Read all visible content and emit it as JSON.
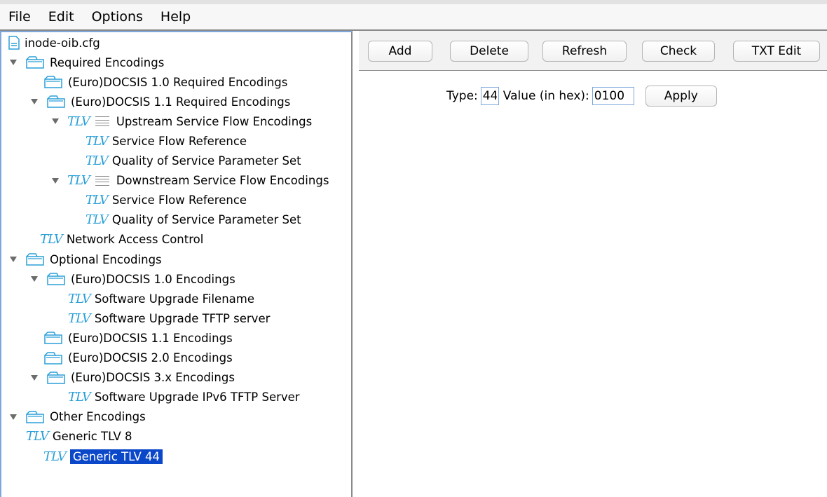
{
  "menu": [
    "File",
    "Edit",
    "Options",
    "Help"
  ],
  "tree": {
    "file": "inode-oib.cfg",
    "nodes": [
      {
        "label": "Required Encodings",
        "icon": "folder-icon"
      },
      {
        "label": "(Euro)DOCSIS 1.0 Required Encodings",
        "icon": "folder-icon"
      },
      {
        "label": "(Euro)DOCSIS 1.1 Required Encodings",
        "icon": "folder-icon"
      },
      {
        "label": "Upstream Service Flow Encodings",
        "icon": "tlv-list-icon"
      },
      {
        "label": "Service Flow Reference",
        "icon": "tlv-icon"
      },
      {
        "label": "Quality of Service Parameter Set",
        "icon": "tlv-icon"
      },
      {
        "label": "Downstream Service Flow Encodings",
        "icon": "tlv-list-icon"
      },
      {
        "label": "Service Flow Reference",
        "icon": "tlv-icon"
      },
      {
        "label": "Quality of Service Parameter Set",
        "icon": "tlv-icon"
      },
      {
        "label": "Network Access Control",
        "icon": "tlv-icon"
      },
      {
        "label": "Optional Encodings",
        "icon": "folder-icon"
      },
      {
        "label": "(Euro)DOCSIS 1.0 Encodings",
        "icon": "folder-icon"
      },
      {
        "label": "Software Upgrade Filename",
        "icon": "tlv-icon"
      },
      {
        "label": "Software Upgrade TFTP server",
        "icon": "tlv-icon"
      },
      {
        "label": "(Euro)DOCSIS 1.1 Encodings",
        "icon": "folder-icon"
      },
      {
        "label": "(Euro)DOCSIS 2.0 Encodings",
        "icon": "folder-icon"
      },
      {
        "label": "(Euro)DOCSIS 3.x Encodings",
        "icon": "folder-icon"
      },
      {
        "label": "Software Upgrade IPv6 TFTP Server",
        "icon": "tlv-icon"
      },
      {
        "label": "Other Encodings",
        "icon": "folder-icon"
      },
      {
        "label": "Generic TLV 8",
        "icon": "tlv-icon"
      },
      {
        "label": "Generic TLV 44",
        "icon": "tlv-icon",
        "selected": true
      }
    ]
  },
  "toolbar": {
    "add": "Add",
    "delete": "Delete",
    "refresh": "Refresh",
    "check": "Check",
    "txt_edit": "TXT Edit"
  },
  "form": {
    "type_label": "Type:",
    "type_value": "44",
    "value_label": "Value (in hex):",
    "value_value": "0100",
    "apply": "Apply"
  },
  "icon_text": {
    "tlv": "TLV"
  },
  "colors": {
    "selection": "#0a47c9",
    "tlv_icon": "#2a9fd8"
  }
}
